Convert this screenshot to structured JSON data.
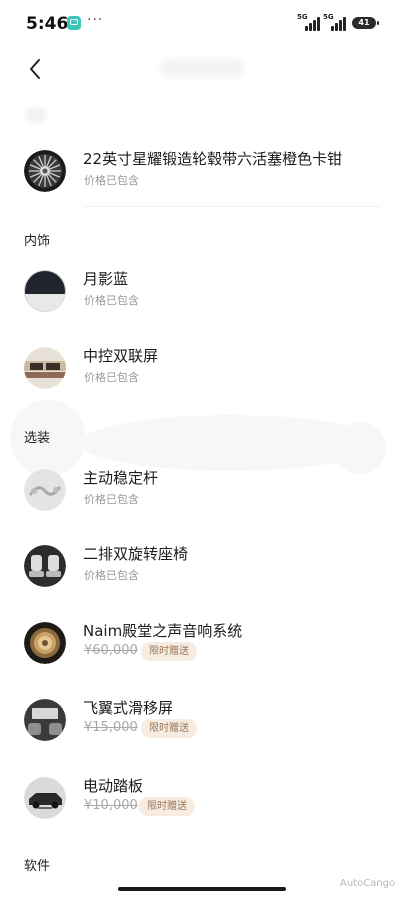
{
  "status_bar": {
    "time": "5:46",
    "dots": "···",
    "signal_1": "5G",
    "signal_2": "5G",
    "battery": "41"
  },
  "header": {
    "back_icon": "chevron-left-icon"
  },
  "sections": {
    "interior": "内饰",
    "options": "选装",
    "software": "软件"
  },
  "items": [
    {
      "name": "22英寸星耀锻造轮毂带六活塞橙色卡钳",
      "sub": "价格已包含",
      "icon": "wheel-icon"
    },
    {
      "name": "月影蓝",
      "sub": "价格已包含",
      "icon": "color-swatch-icon"
    },
    {
      "name": "中控双联屏",
      "sub": "价格已包含",
      "icon": "dashboard-icon"
    },
    {
      "name": "主动稳定杆",
      "sub": "价格已包含",
      "icon": "stabilizer-icon"
    },
    {
      "name": "二排双旋转座椅",
      "sub": "价格已包含",
      "icon": "seat-icon"
    },
    {
      "name": "Naim殿堂之声音响系统",
      "old_price": "¥60,000",
      "badge": "限时赠送",
      "icon": "speaker-icon"
    },
    {
      "name": "飞翼式滑移屏",
      "old_price": "¥15,000",
      "badge": "限时赠送",
      "icon": "screen-icon"
    },
    {
      "name": "电动踏板",
      "old_price": "¥10,000",
      "badge": "限时赠送",
      "icon": "running-board-icon"
    }
  ],
  "watermark": "AutoCango"
}
